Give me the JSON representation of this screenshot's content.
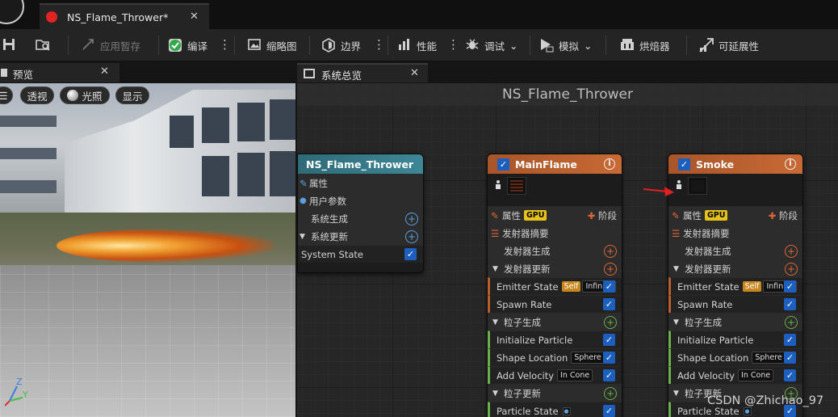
{
  "app": {
    "document_tab": "NS_Flame_Thrower*"
  },
  "toolbar": {
    "apply_draft": "应用暂存",
    "compile": "编译",
    "thumbnail": "缩略图",
    "bounds": "边界",
    "performance": "性能",
    "debug": "调试",
    "simulate": "模拟",
    "baker": "烘焙器",
    "scalability": "可延展性"
  },
  "preview": {
    "tab_label": "预览",
    "perspective": "透视",
    "lighting": "光照",
    "show": "显示",
    "axis_z": "Z",
    "axis_y": "Y"
  },
  "graph": {
    "tab_label": "系统总览",
    "title": "NS_Flame_Thrower",
    "system_node": {
      "title": "NS_Flame_Thrower",
      "rows": [
        "属性",
        "用户参数",
        "系统生成",
        "系统更新",
        "System State"
      ]
    },
    "emitter_labels": {
      "properties": "属性",
      "gpu": "GPU",
      "stage": "阶段",
      "summary": "发射器摘要",
      "emitter_spawn": "发射器生成",
      "emitter_update": "发射器更新",
      "emitter_state": "Emitter State",
      "self": "Self",
      "infinite": "Infinite",
      "spawn_rate": "Spawn Rate",
      "particle_spawn": "粒子生成",
      "initialize_particle": "Initialize Particle",
      "shape_location": "Shape Location",
      "sphere": "Sphere",
      "add_velocity": "Add Velocity",
      "in_cone": "In Cone",
      "particle_update": "粒子更新",
      "particle_state": "Particle State"
    },
    "emitters": [
      {
        "name": "MainFlame"
      },
      {
        "name": "Smoke"
      }
    ]
  },
  "watermark": "CSDN @Zhichao_97",
  "colors": {
    "accent_blue": "#1c5fbf",
    "emitter_header": "#b8602c",
    "system_header": "#2f6a78",
    "plus_orange": "#e0663a",
    "plus_green": "#6ab04c",
    "plus_blue": "#5aa0e0"
  }
}
